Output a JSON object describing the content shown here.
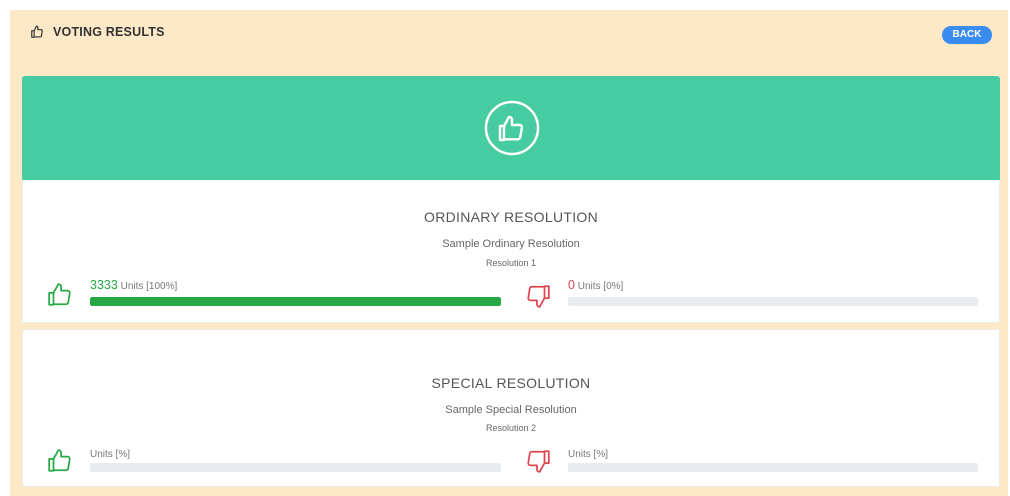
{
  "header": {
    "title": "VOTING RESULTS",
    "icon": "thumbs-up-icon",
    "back_label": "BACK",
    "back_color": "#3b8cf0"
  },
  "banner": {
    "color": "#47cba0",
    "icon": "thumbs-up-icon"
  },
  "resolutions": [
    {
      "title": "ORDINARY RESOLUTION",
      "name": "Sample Ordinary Resolution",
      "number": "Resolution 1",
      "yes": {
        "value": "3333",
        "label": "Units [100%]",
        "fraction": 1.0
      },
      "no": {
        "value": "0",
        "label": "Units [0%]",
        "fraction": 0.0
      }
    },
    {
      "title": "SPECIAL RESOLUTION",
      "name": "Sample Special Resolution",
      "number": "Resolution 2",
      "yes": {
        "value": "",
        "label": "Units [%]",
        "fraction": 0.0
      },
      "no": {
        "value": "",
        "label": "Units [%]",
        "fraction": 0.0
      }
    }
  ],
  "colors": {
    "yes": "#28a745",
    "no": "#e0454f",
    "page_background": "#fde8c8"
  }
}
